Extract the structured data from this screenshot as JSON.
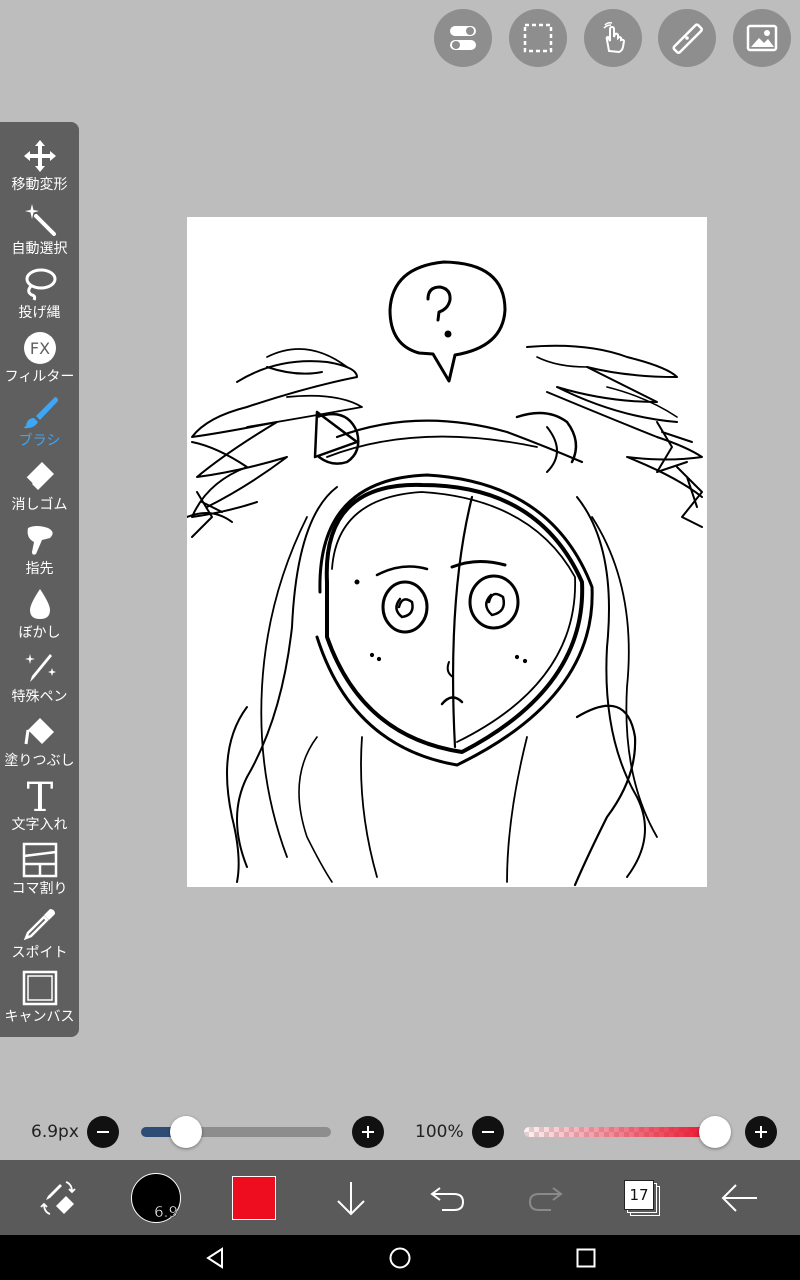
{
  "top_buttons": [
    {
      "name": "toggle-icon"
    },
    {
      "name": "selection-icon"
    },
    {
      "name": "hand-gesture-icon"
    },
    {
      "name": "ruler-icon"
    },
    {
      "name": "image-icon"
    }
  ],
  "tools": [
    {
      "label": "移動変形",
      "icon": "move-icon"
    },
    {
      "label": "自動選択",
      "icon": "magic-wand-icon"
    },
    {
      "label": "投げ縄",
      "icon": "lasso-icon"
    },
    {
      "label": "フィルター",
      "icon": "fx-icon"
    },
    {
      "label": "ブラシ",
      "icon": "brush-icon",
      "active": true
    },
    {
      "label": "消しゴム",
      "icon": "eraser-icon"
    },
    {
      "label": "指先",
      "icon": "finger-icon"
    },
    {
      "label": "ぼかし",
      "icon": "blur-drop-icon"
    },
    {
      "label": "特殊ペン",
      "icon": "special-pen-icon"
    },
    {
      "label": "塗りつぶし",
      "icon": "fill-bucket-icon"
    },
    {
      "label": "文字入れ",
      "icon": "text-icon"
    },
    {
      "label": "コマ割り",
      "icon": "frame-divider-icon"
    },
    {
      "label": "スポイト",
      "icon": "eyedropper-icon"
    },
    {
      "label": "キャンバス",
      "icon": "canvas-icon"
    }
  ],
  "brush_size": {
    "value_label": "6.9px",
    "level": 0.2
  },
  "opacity": {
    "value_label": "100%",
    "level": 1.0
  },
  "bottom": {
    "brush_preview_label": "6.9",
    "color": "#ee0d1e",
    "layer_count": "17"
  },
  "colors": {
    "accent": "#3da7f5",
    "toolbar": "#5f5f5f",
    "bottom_bar": "#5a5a5a",
    "size_track": "#2e4d75",
    "opacity_track": "#e8102a"
  }
}
